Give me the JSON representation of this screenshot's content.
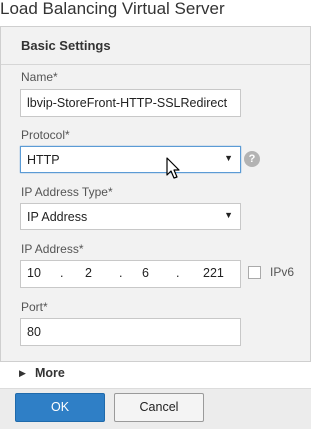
{
  "window": {
    "title": "Load Balancing Virtual Server"
  },
  "section": {
    "title": "Basic Settings"
  },
  "name": {
    "label": "Name*",
    "value": "lbvip-StoreFront-HTTP-SSLRedirect"
  },
  "protocol": {
    "label": "Protocol*",
    "value": "HTTP",
    "help": "?"
  },
  "ip_type": {
    "label": "IP Address Type*",
    "value": "IP Address"
  },
  "ip_address": {
    "label": "IP Address*",
    "octets": [
      "10",
      "2",
      "6",
      "221"
    ],
    "separator": "."
  },
  "ipv6": {
    "label": "IPv6",
    "checked": false
  },
  "port": {
    "label": "Port*",
    "value": "80"
  },
  "more": {
    "label": "More"
  },
  "buttons": {
    "ok": "OK",
    "cancel": "Cancel"
  },
  "icons": {
    "dropdown": "chevron-down-icon",
    "expand": "triangle-right-icon",
    "help": "help-circle-icon",
    "cursor": "mouse-pointer-icon"
  },
  "colors": {
    "primary": "#2f7fc6",
    "focus": "#5b9bd5",
    "panel": "#f2f2f2"
  }
}
